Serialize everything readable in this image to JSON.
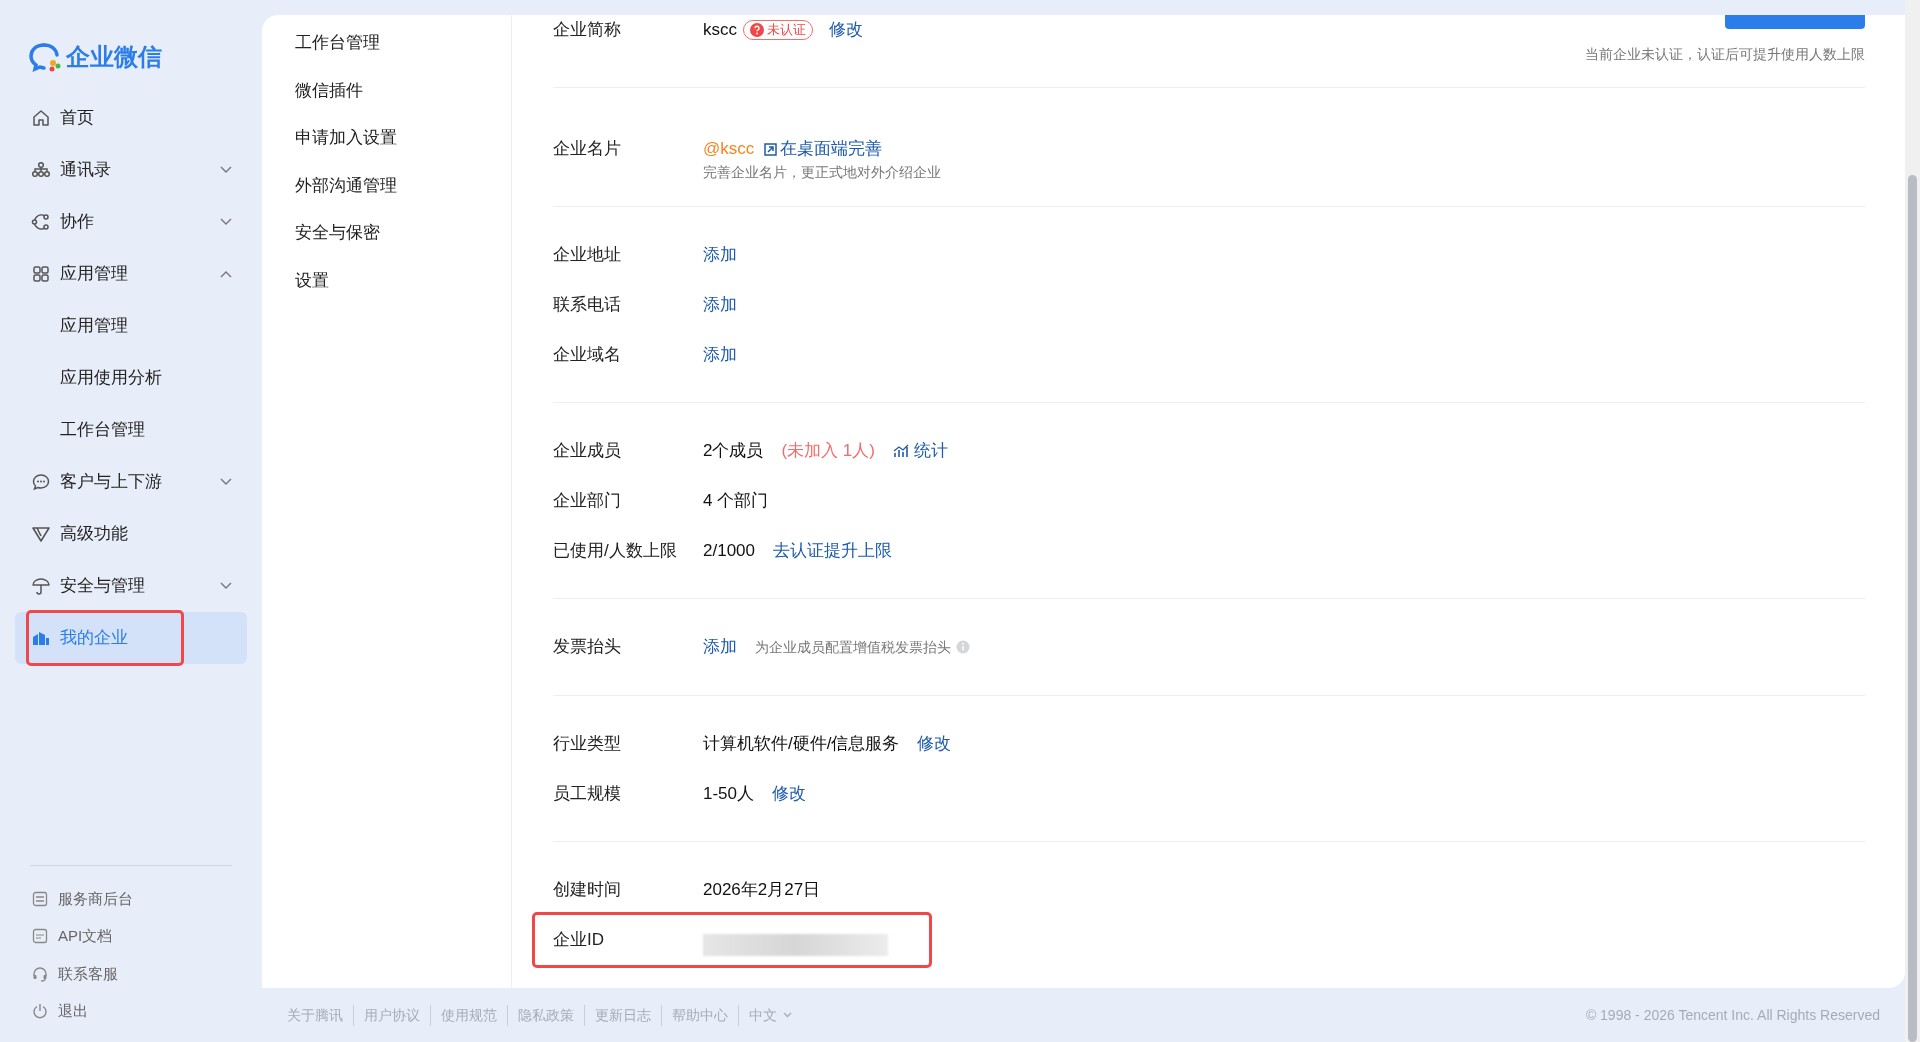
{
  "logo": {
    "text": "企业微信"
  },
  "nav": [
    {
      "label": "首页",
      "kind": "link",
      "selected": false,
      "annotated": false
    },
    {
      "label": "通讯录",
      "kind": "group",
      "expanded": false,
      "selected": false,
      "annotated": false
    },
    {
      "label": "协作",
      "kind": "group",
      "expanded": false,
      "selected": false,
      "annotated": false
    },
    {
      "label": "应用管理",
      "kind": "group",
      "expanded": true,
      "selected": false,
      "annotated": false,
      "children": [
        {
          "label": "应用管理",
          "selected": false
        },
        {
          "label": "应用使用分析",
          "selected": false
        },
        {
          "label": "工作台管理",
          "selected": false
        }
      ]
    },
    {
      "label": "客户与上下游",
      "kind": "group",
      "expanded": false,
      "selected": false,
      "annotated": false
    },
    {
      "label": "高级功能",
      "kind": "link",
      "selected": false,
      "annotated": false
    },
    {
      "label": "安全与管理",
      "kind": "group",
      "expanded": false,
      "selected": false,
      "annotated": false
    },
    {
      "label": "我的企业",
      "kind": "link",
      "selected": true,
      "annotated": true
    }
  ],
  "sidebar_footer": [
    "服务商后台",
    "API文档",
    "联系客服",
    "退出"
  ],
  "subnav": [
    "工作台管理",
    "微信插件",
    "申请加入设置",
    "外部沟通管理",
    "安全与保密",
    "设置"
  ],
  "top_notice": "当前企业未认证，认证后可提升使用人数上限",
  "sections": [
    {
      "rows": [
        {
          "label": "企业简称",
          "annotated": false,
          "parts": [
            {
              "kind": "text",
              "text": "kscc"
            },
            {
              "kind": "badge",
              "text": "未认证"
            },
            {
              "kind": "link",
              "text": "修改"
            }
          ]
        }
      ]
    },
    {
      "rows": [
        {
          "label": "企业名片",
          "annotated": false,
          "parts": [
            {
              "kind": "handle",
              "text": "@kscc"
            },
            {
              "kind": "external_link",
              "text": "在桌面端完善"
            }
          ],
          "note": "完善企业名片，更正式地对外介绍企业"
        }
      ]
    },
    {
      "rows": [
        {
          "label": "企业地址",
          "annotated": false,
          "parts": [
            {
              "kind": "link",
              "text": "添加"
            }
          ]
        },
        {
          "label": "联系电话",
          "annotated": false,
          "parts": [
            {
              "kind": "link",
              "text": "添加"
            }
          ]
        },
        {
          "label": "企业域名",
          "annotated": false,
          "parts": [
            {
              "kind": "link",
              "text": "添加"
            }
          ]
        }
      ]
    },
    {
      "rows": [
        {
          "label": "企业成员",
          "annotated": false,
          "parts": [
            {
              "kind": "text",
              "text": "2个成员"
            },
            {
              "kind": "warning",
              "text": "(未加入 1人)"
            },
            {
              "kind": "stats_link",
              "text": "统计"
            }
          ]
        },
        {
          "label": "企业部门",
          "annotated": false,
          "parts": [
            {
              "kind": "text",
              "text": "4 个部门"
            }
          ]
        },
        {
          "label": "已使用/人数上限",
          "annotated": false,
          "parts": [
            {
              "kind": "text",
              "text": "2/1000"
            },
            {
              "kind": "link",
              "text": "去认证提升上限"
            }
          ]
        }
      ]
    },
    {
      "rows": [
        {
          "label": "发票抬头",
          "annotated": false,
          "parts": [
            {
              "kind": "link",
              "text": "添加"
            },
            {
              "kind": "hint",
              "text": "为企业成员配置增值税发票抬头"
            }
          ]
        }
      ]
    },
    {
      "rows": [
        {
          "label": "行业类型",
          "annotated": false,
          "parts": [
            {
              "kind": "text",
              "text": "计算机软件/硬件/信息服务"
            },
            {
              "kind": "link",
              "text": "修改"
            }
          ]
        },
        {
          "label": "员工规模",
          "annotated": false,
          "parts": [
            {
              "kind": "text",
              "text": "1-50人"
            },
            {
              "kind": "link",
              "text": "修改"
            }
          ]
        }
      ]
    },
    {
      "rows": [
        {
          "label": "创建时间",
          "annotated": false,
          "parts": [
            {
              "kind": "text",
              "text": "2026年2月27日"
            }
          ]
        },
        {
          "label": "企业ID",
          "annotated": true,
          "parts": [
            {
              "kind": "redacted"
            }
          ]
        }
      ]
    }
  ],
  "footer_links": [
    "关于腾讯",
    "用户协议",
    "使用规范",
    "隐私政策",
    "更新日志",
    "帮助中心"
  ],
  "language": "中文",
  "copyright": "© 1998 - 2026 Tencent Inc. All Rights Reserved"
}
